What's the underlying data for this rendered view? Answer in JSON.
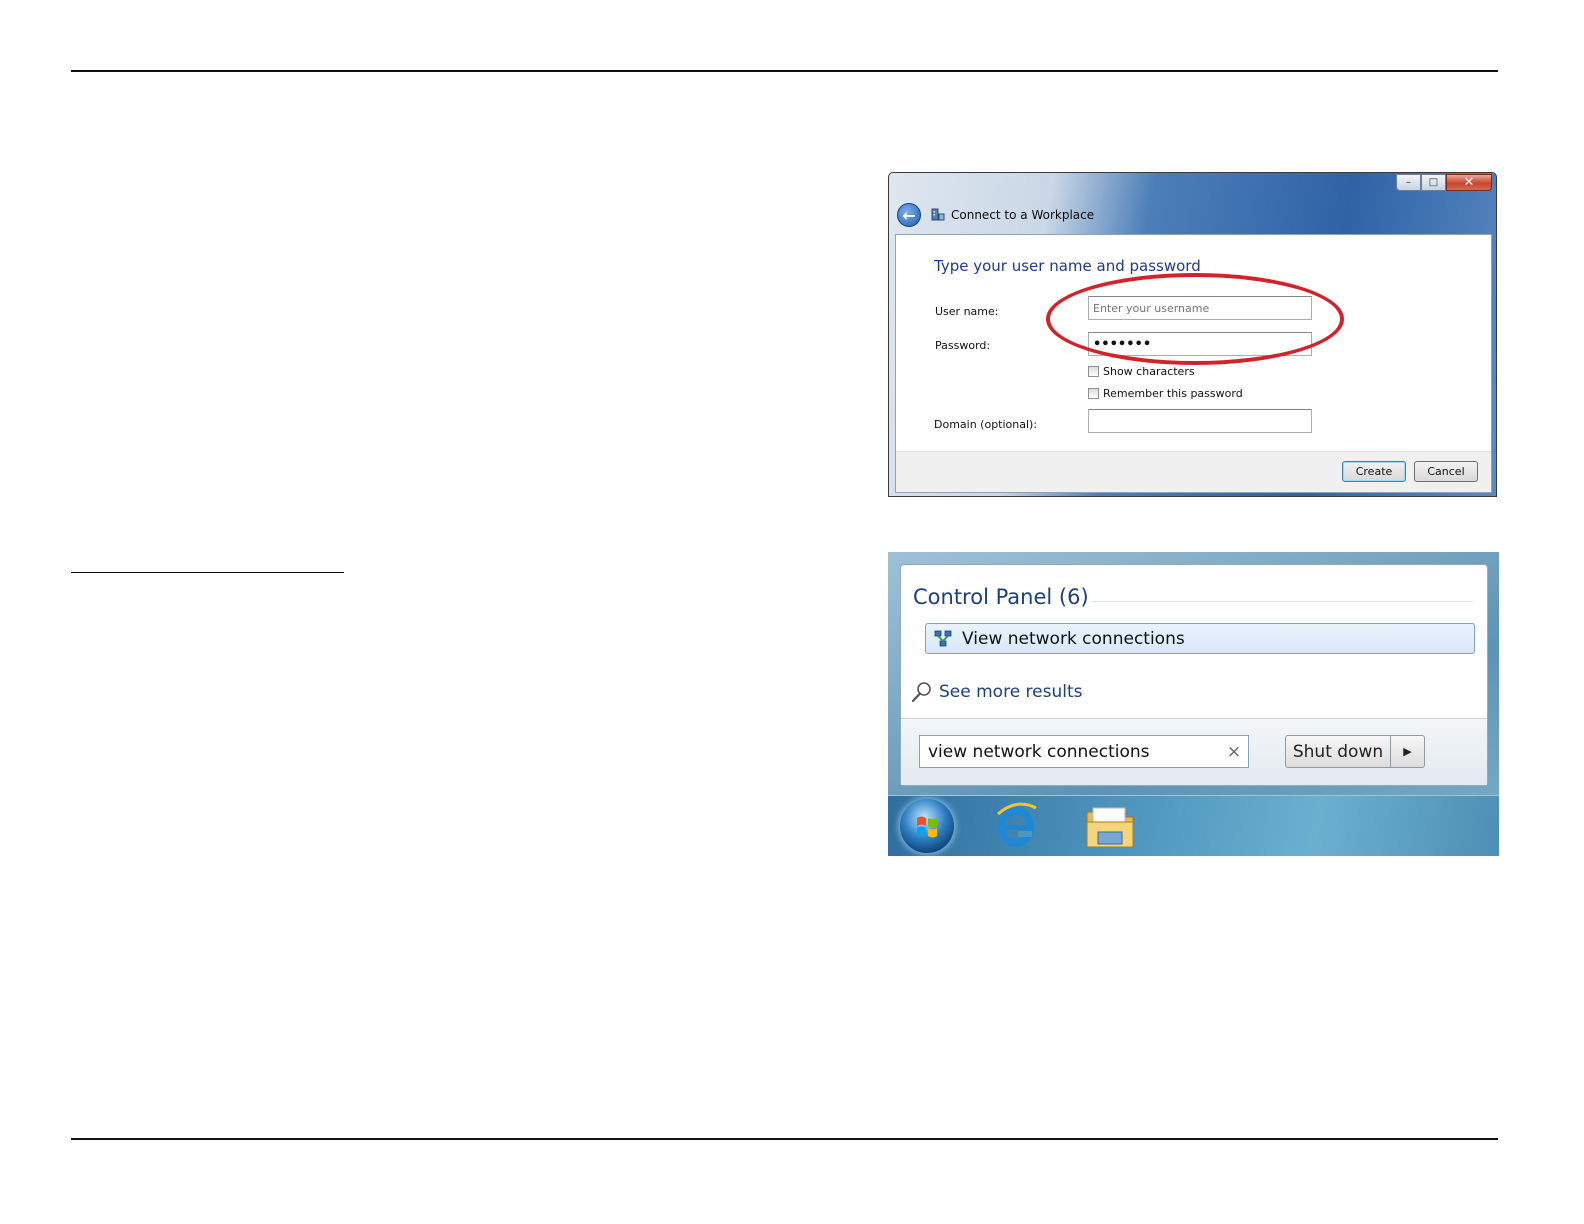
{
  "dialog": {
    "title": "Connect to a Workplace",
    "heading": "Type your user name and password",
    "username_label": "User name:",
    "username_placeholder": "Enter your username",
    "password_label": "Password:",
    "password_value": "•••••••",
    "show_characters_label": "Show characters",
    "remember_password_label": "Remember this password",
    "domain_label": "Domain (optional):",
    "domain_value": "",
    "create_label": "Create",
    "cancel_label": "Cancel",
    "minimize_glyph": "–",
    "maximize_glyph": "□",
    "close_glyph": "✕",
    "highlight_color": "#d2232a"
  },
  "start_menu": {
    "category_heading": "Control Panel (6)",
    "result_label": "View network connections",
    "see_more_label": "See more results",
    "search_value": "view network connections",
    "clear_glyph": "×",
    "shutdown_label": "Shut down",
    "shutdown_arrow_glyph": "▶"
  },
  "taskbar": {
    "icons": [
      "windows-orb-icon",
      "internet-explorer-icon",
      "file-explorer-folder-icon"
    ]
  }
}
